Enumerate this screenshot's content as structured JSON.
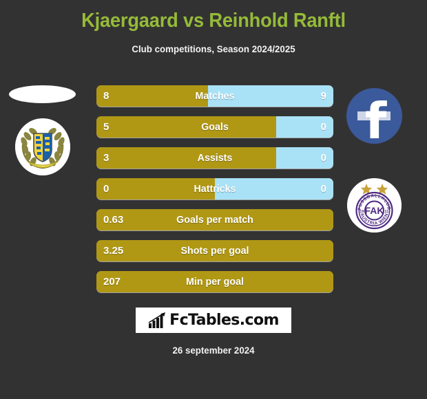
{
  "header": {
    "title": "Kjaergaard vs Reinhold Ranftl",
    "subtitle": "Club competitions, Season 2024/2025",
    "title_color": "#95bb38"
  },
  "colors": {
    "background": "#333233",
    "bar_left": "#b09815",
    "bar_right": "#a9e2f7",
    "text": "#ffffff"
  },
  "chart_data": {
    "type": "bar",
    "title": "Kjaergaard vs Reinhold Ranftl",
    "subtitle": "Club competitions, Season 2024/2025",
    "orientation": "horizontal-diverging",
    "categories": [
      "Matches",
      "Goals",
      "Assists",
      "Hattricks",
      "Goals per match",
      "Shots per goal",
      "Min per goal"
    ],
    "series": [
      {
        "name": "Kjaergaard",
        "color": "#b09815",
        "values": [
          "8",
          "5",
          "3",
          "0",
          "0.63",
          "3.25",
          "207"
        ]
      },
      {
        "name": "Reinhold Ranftl",
        "color": "#a9e2f7",
        "values": [
          "9",
          "0",
          "0",
          "0",
          "",
          "",
          ""
        ]
      }
    ],
    "legend": "none",
    "grid": false
  },
  "stats": {
    "rows": [
      {
        "label": "Matches",
        "left": "8",
        "right": "9",
        "left_pct": 47,
        "has_right": true
      },
      {
        "label": "Goals",
        "left": "5",
        "right": "0",
        "left_pct": 76,
        "has_right": true
      },
      {
        "label": "Assists",
        "left": "3",
        "right": "0",
        "left_pct": 76,
        "has_right": true
      },
      {
        "label": "Hattricks",
        "left": "0",
        "right": "0",
        "left_pct": 50,
        "has_right": true
      },
      {
        "label": "Goals per match",
        "left": "0.63",
        "right": "",
        "left_pct": 100,
        "has_right": false
      },
      {
        "label": "Shots per goal",
        "left": "3.25",
        "right": "",
        "left_pct": 100,
        "has_right": false
      },
      {
        "label": "Min per goal",
        "left": "207",
        "right": "",
        "left_pct": 100,
        "has_right": false
      }
    ]
  },
  "logos": {
    "left_top": {
      "name": "home-team-badge-partial"
    },
    "left_bottom": {
      "name": "home-team-crest-laurel"
    },
    "right_top": {
      "name": "facebook-badge",
      "glyph": "f"
    },
    "right_bottom": {
      "name": "austria-wien-crest",
      "text_top": "FUSSBALLKLUB",
      "text_bottom": "AUSTRIA WIEN",
      "monogram": "FAK",
      "year_left": "19",
      "year_right": "11"
    }
  },
  "footer": {
    "brand": "FcTables.com",
    "date": "26 september 2024"
  }
}
